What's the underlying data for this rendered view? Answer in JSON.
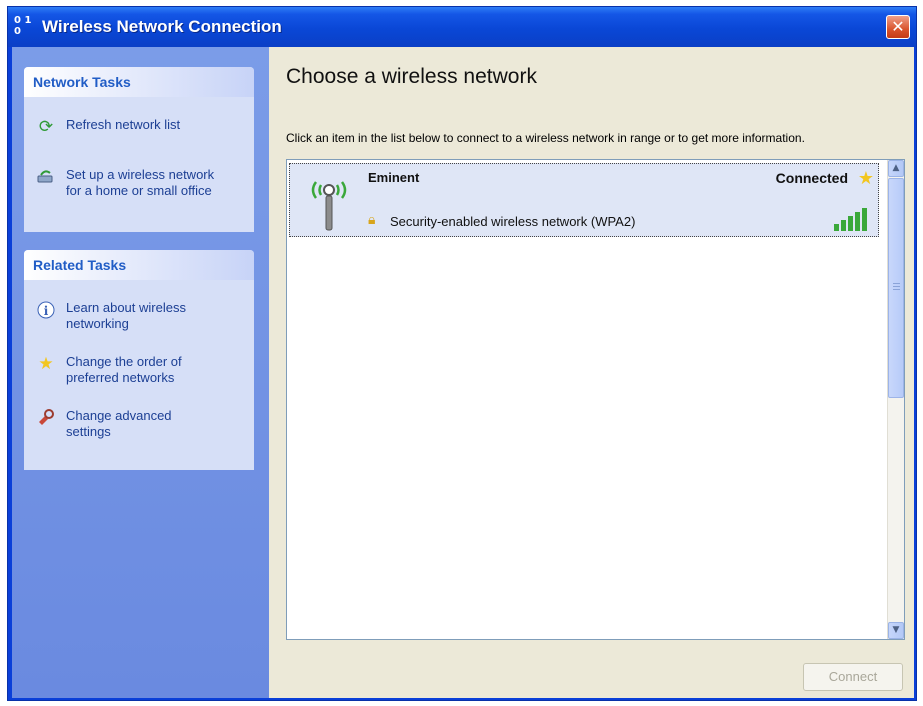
{
  "window": {
    "title": "Wireless Network Connection",
    "title_icon_text": "0 1 0",
    "close_glyph": "✕"
  },
  "sidebar": {
    "network_tasks": {
      "header": "Network Tasks",
      "items": [
        {
          "label": "Refresh network list",
          "icon": "refresh-icon"
        },
        {
          "label": "Set up a wireless network for a home or small office",
          "icon": "setup-network-icon"
        }
      ]
    },
    "related_tasks": {
      "header": "Related Tasks",
      "items": [
        {
          "label": "Learn about wireless networking",
          "icon": "info-icon"
        },
        {
          "label": "Change the order of preferred networks",
          "icon": "star-icon"
        },
        {
          "label": "Change advanced settings",
          "icon": "settings-icon"
        }
      ]
    }
  },
  "main": {
    "heading": "Choose a wireless network",
    "description": "Click an item in the list below to connect to a wireless network in range or to get more information.",
    "networks": [
      {
        "name": "Eminent",
        "status": "Connected",
        "security": "Security-enabled wireless network (WPA2)",
        "preferred": true,
        "signal_bars": 5
      }
    ],
    "connect_button": "Connect"
  },
  "colors": {
    "titlebar": "#0a47d6",
    "sidebar": "#6a8ae0",
    "panel": "#d6dff7",
    "panel_header_text": "#215dc6",
    "content_bg": "#ece9d8",
    "signal_green": "#3aa83a"
  }
}
